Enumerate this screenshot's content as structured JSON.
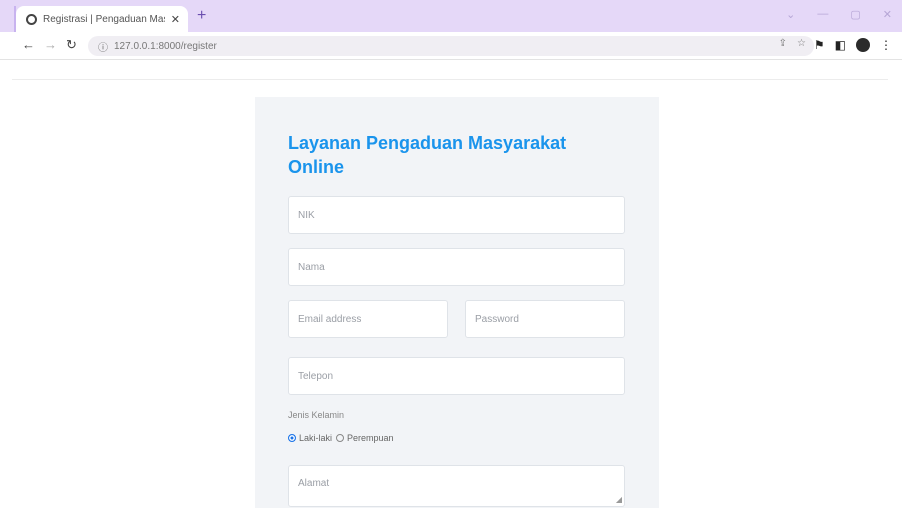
{
  "browser": {
    "tab_title": "Registrasi | Pengaduan Masyarak",
    "tab_close": "✕",
    "new_tab": "+",
    "url": "127.0.0.1:8000/register",
    "win_controls": [
      "⌄",
      "—",
      "▢",
      "✕"
    ]
  },
  "form": {
    "heading": "Layanan Pengaduan Masyarakat Online",
    "nik_placeholder": "NIK",
    "nama_placeholder": "Nama",
    "email_placeholder": "Email address",
    "password_placeholder": "Password",
    "telepon_placeholder": "Telepon",
    "gender_label": "Jenis Kelamin",
    "gender_options": [
      {
        "label": "Laki-laki",
        "selected": true
      },
      {
        "label": "Perempuan",
        "selected": false
      }
    ],
    "alamat_placeholder": "Alamat"
  },
  "colors": {
    "accent": "#1a94ec",
    "tab_bar": "#e5d8f8",
    "card_bg": "#f2f4f7"
  }
}
